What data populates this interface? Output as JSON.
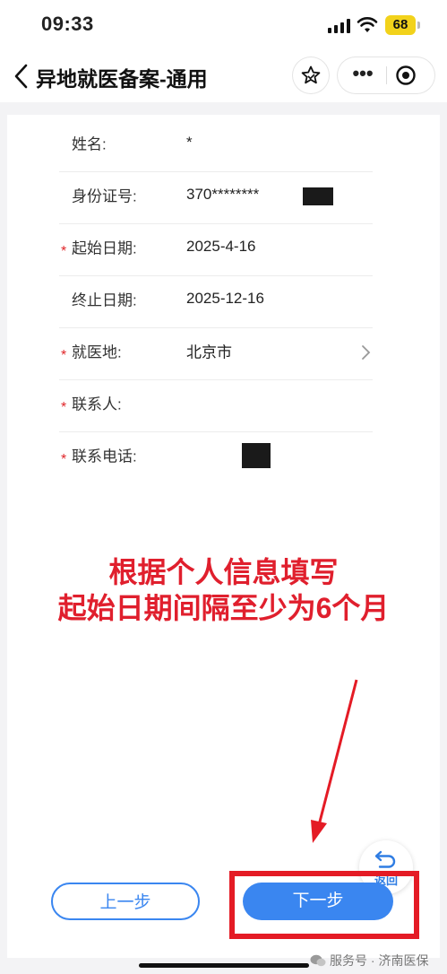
{
  "status_bar": {
    "time": "09:33",
    "battery": "68",
    "icons": [
      "signal-icon",
      "wifi-icon",
      "battery-icon"
    ]
  },
  "nav": {
    "back_icon": "chevron-left-icon",
    "title": "异地就医备案-通用",
    "more_label": "•••",
    "icons": [
      "star-icon",
      "more-icon",
      "record-icon"
    ]
  },
  "form": {
    "rows": [
      {
        "label": "姓名:",
        "value": "*",
        "required": false
      },
      {
        "label": "身份证号:",
        "value": "370********",
        "required": false
      },
      {
        "label": "起始日期:",
        "value": "2025-4-16",
        "required": true
      },
      {
        "label": "终止日期:",
        "value": "2025-12-16",
        "required": false
      },
      {
        "label": "就医地:",
        "value": "北京市",
        "required": true
      },
      {
        "label": "联系人:",
        "value": "",
        "required": true
      },
      {
        "label": "联系电话:",
        "value": "",
        "required": true
      }
    ],
    "required_mark": "*"
  },
  "instruction": {
    "line1": "根据个人信息填写",
    "line2": "起始日期间隔至少为6个月"
  },
  "floating": {
    "return_label": "返回",
    "icon": "return-arrow-icon"
  },
  "buttons": {
    "prev": "上一步",
    "next": "下一步"
  },
  "watermark": {
    "text": "服务号 · 济南医保",
    "icon": "wechat-icon"
  },
  "colors": {
    "accent": "#3a86f0",
    "annotation_red": "#e41b25",
    "required_red": "#e0262a",
    "battery": "#f2d21b"
  }
}
